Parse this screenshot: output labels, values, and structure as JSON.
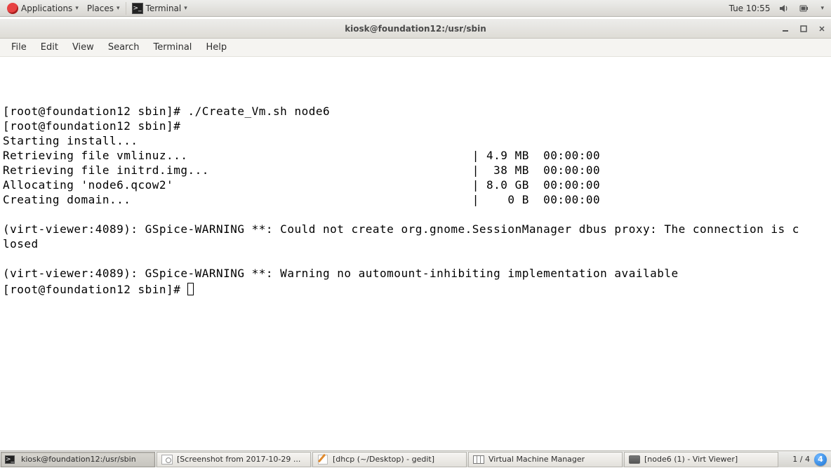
{
  "topbar": {
    "applications_label": "Applications",
    "places_label": "Places",
    "terminal_label": "Terminal",
    "clock": "Tue 10:55"
  },
  "window": {
    "title": "kiosk@foundation12:/usr/sbin"
  },
  "menubar": {
    "file": "File",
    "edit": "Edit",
    "view": "View",
    "search": "Search",
    "terminal": "Terminal",
    "help": "Help"
  },
  "terminal": {
    "lines": [
      "",
      "",
      "",
      "[root@foundation12 sbin]# ./Create_Vm.sh node6",
      "[root@foundation12 sbin]# ",
      "Starting install...",
      "Retrieving file vmlinuz...                                        | 4.9 MB  00:00:00",
      "Retrieving file initrd.img...                                     |  38 MB  00:00:00",
      "Allocating 'node6.qcow2'                                          | 8.0 GB  00:00:00",
      "Creating domain...                                                |    0 B  00:00:00",
      "",
      "(virt-viewer:4089): GSpice-WARNING **: Could not create org.gnome.SessionManager dbus proxy: The connection is c",
      "losed",
      "",
      "(virt-viewer:4089): GSpice-WARNING **: Warning no automount-inhibiting implementation available",
      "[root@foundation12 sbin]# "
    ]
  },
  "taskbar": {
    "items": [
      {
        "label": "kiosk@foundation12:/usr/sbin"
      },
      {
        "label": "[Screenshot from 2017-10-29 ..."
      },
      {
        "label": "[dhcp (~/Desktop) - gedit]"
      },
      {
        "label": "Virtual Machine Manager"
      },
      {
        "label": "[node6 (1) - Virt Viewer]"
      }
    ],
    "workspace_count": "1 / 4",
    "workspace_badge": "4"
  }
}
